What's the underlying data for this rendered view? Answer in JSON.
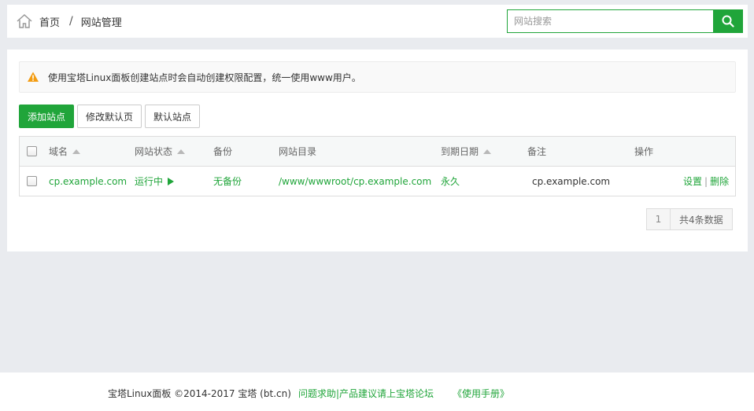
{
  "breadcrumb": {
    "home": "首页",
    "separator": "/",
    "current": "网站管理"
  },
  "search": {
    "placeholder": "网站搜索",
    "value": ""
  },
  "notice": {
    "icon": "warning-icon",
    "text": "使用宝塔Linux面板创建站点时会自动创建权限配置，统一使用www用户。"
  },
  "toolbar": {
    "add_site": "添加站点",
    "edit_default_page": "修改默认页",
    "default_site": "默认站点"
  },
  "table": {
    "headers": {
      "domain": "域名",
      "status": "网站状态",
      "backup": "备份",
      "root": "网站目录",
      "expire": "到期日期",
      "remark": "备注",
      "actions": "操作"
    },
    "rows": [
      {
        "domain": "cp.example.com",
        "status": "运行中",
        "backup": "无备份",
        "root": "/www/wwwroot/cp.example.com",
        "expire": "永久",
        "remark": "cp.example.com",
        "action_settings": "设置",
        "action_separator": "|",
        "action_delete": "删除"
      }
    ]
  },
  "pagination": {
    "current_page": "1",
    "total_text": "共4条数据"
  },
  "footer": {
    "copyright": "宝塔Linux面板 ©2014-2017 宝塔 (bt.cn)",
    "help_link": "问题求助|产品建议请上宝塔论坛",
    "manual_link": "《使用手册》"
  },
  "colors": {
    "accent": "#20a53a",
    "background": "#e9ebef",
    "warning": "#f39c12"
  }
}
